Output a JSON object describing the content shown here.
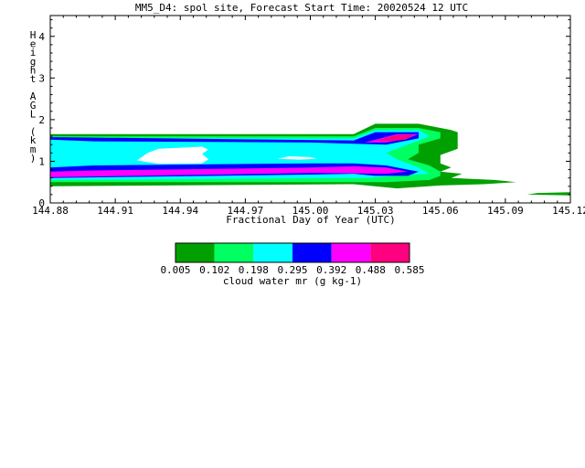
{
  "chart_data": {
    "type": "contour",
    "title": "MM5_D4: spol site,  Forecast Start Time: 20020524 12 UTC",
    "xlabel": "Fractional Day of Year (UTC)",
    "ylabel": "Height AGL (km)",
    "xlim": [
      144.88,
      145.12
    ],
    "ylim": [
      0,
      4.5
    ],
    "x_ticks": [
      144.88,
      144.91,
      144.94,
      144.97,
      145.0,
      145.03,
      145.06,
      145.09,
      145.12
    ],
    "x_tick_labels": [
      "144.88",
      "144.91",
      "144.94",
      "144.97",
      "145.00",
      "145.03",
      "145.06",
      "145.09",
      "145.12"
    ],
    "y_ticks": [
      0,
      1,
      2,
      3,
      4
    ],
    "y_tick_labels": [
      "0",
      "1",
      "2",
      "3",
      "4"
    ],
    "colorbar": {
      "label": "cloud water mr (g kg-1)",
      "levels": [
        0.005,
        0.102,
        0.198,
        0.295,
        0.392,
        0.488,
        0.585
      ],
      "level_labels": [
        "0.005",
        "0.102",
        "0.198",
        "0.295",
        "0.392",
        "0.488",
        "0.585"
      ],
      "colors": [
        "#00a000",
        "#00ff60",
        "#00ffff",
        "#0000ff",
        "#ff00ff",
        "#ff0080"
      ]
    },
    "regions": [
      {
        "level": 0,
        "polygons": [
          [
            [
              144.88,
              1.65
            ],
            [
              145.02,
              1.65
            ],
            [
              145.03,
              1.9
            ],
            [
              145.05,
              1.9
            ],
            [
              145.065,
              1.75
            ],
            [
              145.068,
              1.7
            ],
            [
              145.068,
              1.3
            ],
            [
              145.06,
              1.15
            ],
            [
              145.06,
              0.95
            ],
            [
              145.065,
              0.85
            ],
            [
              145.06,
              0.75
            ],
            [
              145.07,
              0.7
            ],
            [
              145.065,
              0.6
            ],
            [
              145.085,
              0.55
            ],
            [
              145.095,
              0.5
            ],
            [
              145.08,
              0.45
            ],
            [
              145.06,
              0.42
            ],
            [
              145.04,
              0.35
            ],
            [
              145.02,
              0.45
            ],
            [
              144.88,
              0.4
            ]
          ],
          [
            [
              145.1,
              0.2
            ],
            [
              145.12,
              0.18
            ],
            [
              145.12,
              0.26
            ],
            [
              145.105,
              0.24
            ]
          ]
        ]
      },
      {
        "level": 1,
        "polygons": [
          [
            [
              144.88,
              1.6
            ],
            [
              145.02,
              1.6
            ],
            [
              145.03,
              1.8
            ],
            [
              145.05,
              1.8
            ],
            [
              145.06,
              1.7
            ],
            [
              145.06,
              1.55
            ],
            [
              145.05,
              1.4
            ],
            [
              145.05,
              1.2
            ],
            [
              145.045,
              1.05
            ],
            [
              145.055,
              0.9
            ],
            [
              145.06,
              0.75
            ],
            [
              145.06,
              0.65
            ],
            [
              145.055,
              0.55
            ],
            [
              145.035,
              0.5
            ],
            [
              144.88,
              0.5
            ]
          ]
        ]
      },
      {
        "level": 2,
        "polygons": [
          [
            [
              144.88,
              1.55
            ],
            [
              145.02,
              1.55
            ],
            [
              145.03,
              1.75
            ],
            [
              145.05,
              1.75
            ],
            [
              145.055,
              1.6
            ],
            [
              145.045,
              1.4
            ],
            [
              145.035,
              1.2
            ],
            [
              145.04,
              1.05
            ],
            [
              145.05,
              0.85
            ],
            [
              145.055,
              0.7
            ],
            [
              145.04,
              0.65
            ],
            [
              145.025,
              0.6
            ],
            [
              144.88,
              0.55
            ]
          ]
        ]
      },
      {
        "level": 3,
        "polygons": [
          [
            [
              144.88,
              1.52
            ],
            [
              144.9,
              1.48
            ],
            [
              145.0,
              1.45
            ],
            [
              145.02,
              1.42
            ],
            [
              145.035,
              1.4
            ],
            [
              145.05,
              1.55
            ],
            [
              145.05,
              1.7
            ],
            [
              145.03,
              1.7
            ],
            [
              145.02,
              1.5
            ],
            [
              144.88,
              1.58
            ]
          ],
          [
            [
              144.88,
              0.85
            ],
            [
              144.9,
              0.9
            ],
            [
              145.0,
              0.95
            ],
            [
              145.02,
              0.95
            ],
            [
              145.035,
              0.9
            ],
            [
              145.045,
              0.8
            ],
            [
              145.05,
              0.75
            ],
            [
              145.045,
              0.65
            ],
            [
              145.03,
              0.65
            ],
            [
              145.02,
              0.7
            ],
            [
              145.0,
              0.68
            ],
            [
              144.88,
              0.6
            ]
          ]
        ]
      },
      {
        "level": 4,
        "polygons": [
          [
            [
              145.025,
              1.45
            ],
            [
              145.04,
              1.65
            ],
            [
              145.05,
              1.65
            ],
            [
              145.045,
              1.55
            ],
            [
              145.035,
              1.45
            ]
          ],
          [
            [
              144.88,
              0.75
            ],
            [
              144.9,
              0.78
            ],
            [
              145.0,
              0.85
            ],
            [
              145.02,
              0.88
            ],
            [
              145.035,
              0.85
            ],
            [
              145.045,
              0.75
            ],
            [
              145.035,
              0.7
            ],
            [
              145.0,
              0.72
            ],
            [
              144.88,
              0.62
            ]
          ]
        ]
      },
      {
        "level": 5,
        "polygons": [
          [
            [
              145.03,
              1.5
            ],
            [
              145.04,
              1.63
            ],
            [
              145.048,
              1.63
            ],
            [
              145.044,
              1.52
            ],
            [
              145.036,
              1.48
            ]
          ]
        ]
      }
    ],
    "holes": [
      [
        [
          144.92,
          1.02
        ],
        [
          144.925,
          1.2
        ],
        [
          144.93,
          1.3
        ],
        [
          144.95,
          1.35
        ],
        [
          144.953,
          1.28
        ],
        [
          144.95,
          1.18
        ],
        [
          144.953,
          1.05
        ],
        [
          144.95,
          0.95
        ],
        [
          144.93,
          0.94
        ]
      ],
      [
        [
          144.985,
          1.06
        ],
        [
          144.99,
          1.12
        ],
        [
          145.0,
          1.1
        ],
        [
          145.003,
          1.06
        ],
        [
          144.995,
          1.04
        ]
      ]
    ]
  }
}
